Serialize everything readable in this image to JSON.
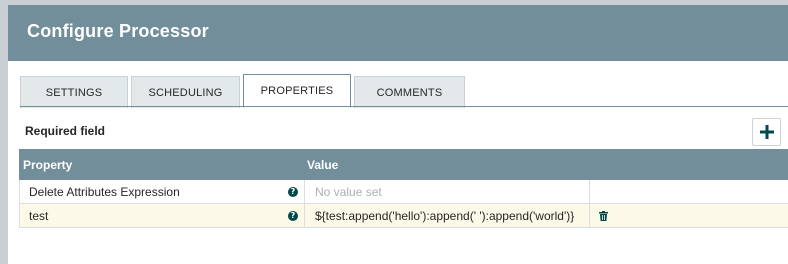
{
  "dialog": {
    "title": "Configure Processor"
  },
  "tabs": [
    {
      "label": "SETTINGS",
      "active": false
    },
    {
      "label": "SCHEDULING",
      "active": false
    },
    {
      "label": "PROPERTIES",
      "active": true
    },
    {
      "label": "COMMENTS",
      "active": false
    }
  ],
  "properties": {
    "required_label": "Required field",
    "add_button_icon": "plus-icon",
    "columns": {
      "property": "Property",
      "value": "Value"
    },
    "rows": [
      {
        "name": "Delete Attributes Expression",
        "value": "No value set",
        "value_is_placeholder": true,
        "help_icon": "help-icon",
        "has_delete": false
      },
      {
        "name": "test",
        "value": "${test:append('hello'):append(' '):append('world')}",
        "value_is_placeholder": false,
        "help_icon": "help-icon",
        "delete_icon": "trash-icon",
        "has_delete": true
      }
    ]
  },
  "colors": {
    "header": "#728e9b",
    "accent": "#004849",
    "selected_row": "#fcf9e9"
  }
}
